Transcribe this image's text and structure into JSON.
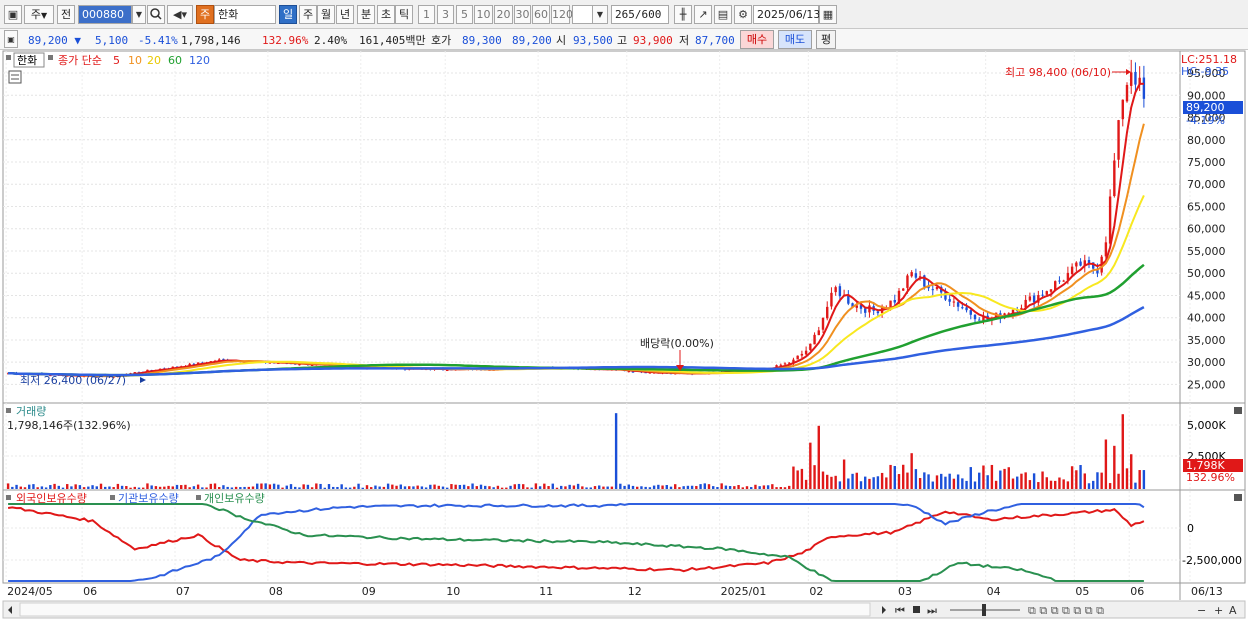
{
  "toolbar": {
    "market": "주",
    "prev": "전",
    "code": "000880",
    "name": "한화",
    "name_tag": "주",
    "periods": [
      "일",
      "주",
      "월",
      "년",
      "분",
      "초",
      "틱"
    ],
    "active_period": "일",
    "intervals": [
      "1",
      "3",
      "5",
      "10",
      "20",
      "30",
      "60",
      "120"
    ],
    "count": "265",
    "count_total": "/600",
    "date": "2025/06/13"
  },
  "quote": {
    "price": "89,200",
    "direction": "▼",
    "change": "5,100",
    "change_pct": "-5.41%",
    "volume": "1,798,146",
    "volume_ratio": "132.96%",
    "turnover": "2.40%",
    "amount": "161,405백만",
    "ask_label": "호가",
    "ask": "89,300",
    "bid": "89,200",
    "open_label": "시",
    "open": "93,500",
    "high_label": "고",
    "high": "93,900",
    "low_label": "저",
    "low": "87,700",
    "buy": "매수",
    "sell": "매도",
    "eval": "평"
  },
  "price_panel": {
    "title": "한화",
    "legend_label": "종가 단순",
    "ma_labels": [
      "5",
      "10",
      "20",
      "60",
      "120"
    ],
    "lc": "LC:251.18",
    "hc": "HC:-9.35",
    "high_annot": "최고 98,400 (06/10)",
    "low_annot": "최저 26,400 (06/27)",
    "dividend_annot": "배당락(0.00%)",
    "last_price": "89,200",
    "last_pct": "-4.19%"
  },
  "volume_panel": {
    "title": "거래량",
    "value": "1,798,146주(132.96%)",
    "last": "1,798K",
    "last_pct": "132.96%"
  },
  "holding_panel": {
    "foreign": "외국인보유수량",
    "inst": "기관보유수량",
    "indiv": "개인보유수량"
  },
  "colors": {
    "up": "#e01818",
    "down": "#1a4fd8",
    "ma5": "#e01818",
    "ma10": "#f09020",
    "ma20": "#f8e820",
    "ma60": "#20a030",
    "ma120": "#3060e0",
    "foreign": "#e01818",
    "inst": "#3060e0",
    "indiv": "#2a9050"
  },
  "chart_data": [
    {
      "type": "candlestick",
      "title": "한화",
      "y_ticks": [
        25000,
        30000,
        35000,
        40000,
        45000,
        50000,
        55000,
        60000,
        65000,
        70000,
        75000,
        80000,
        85000,
        90000,
        95000
      ],
      "y_tick_labels": [
        "25,000",
        "30,000",
        "35,000",
        "40,000",
        "45,000",
        "50,000",
        "55,000",
        "60,000",
        "65,000",
        "70,000",
        "75,000",
        "80,000",
        "85,000",
        "90,000",
        "95,000"
      ],
      "ylim": [
        21500,
        99500
      ],
      "x_labels": [
        "2024/05",
        "06",
        "07",
        "08",
        "09",
        "10",
        "11",
        "12",
        "2025/01",
        "02",
        "03",
        "04",
        "05",
        "06",
        "06/13"
      ],
      "close_anchors": [
        [
          0,
          27500
        ],
        [
          15,
          27000
        ],
        [
          25,
          26800
        ],
        [
          30,
          27700
        ],
        [
          40,
          29000
        ],
        [
          50,
          30500
        ],
        [
          60,
          30000
        ],
        [
          70,
          29600
        ],
        [
          80,
          29000
        ],
        [
          95,
          28500
        ],
        [
          110,
          28400
        ],
        [
          120,
          28600
        ],
        [
          130,
          28800
        ],
        [
          140,
          28400
        ],
        [
          150,
          27900
        ],
        [
          160,
          27400
        ],
        [
          170,
          27600
        ],
        [
          180,
          28600
        ],
        [
          186,
          30200
        ],
        [
          190,
          33500
        ],
        [
          194,
          42500
        ],
        [
          196,
          46500
        ],
        [
          200,
          43000
        ],
        [
          205,
          41500
        ],
        [
          210,
          44000
        ],
        [
          214,
          50000
        ],
        [
          218,
          47000
        ],
        [
          222,
          45000
        ],
        [
          228,
          41000
        ],
        [
          232,
          39500
        ],
        [
          238,
          42000
        ],
        [
          244,
          45000
        ],
        [
          250,
          49000
        ],
        [
          254,
          52000
        ],
        [
          258,
          51000
        ],
        [
          260,
          58000
        ],
        [
          262,
          75000
        ],
        [
          264,
          90000
        ],
        [
          266,
          96000
        ],
        [
          268,
          92000
        ],
        [
          269,
          89200
        ]
      ],
      "ma_labels": [
        "5",
        "10",
        "20",
        "60",
        "120"
      ],
      "annotations": [
        "최고 98,400 (06/10)",
        "최저 26,400 (06/27)",
        "배당락(0.00%)"
      ]
    },
    {
      "type": "bar",
      "title": "거래량",
      "y_tick_labels": [
        "5,000K",
        "2,500K"
      ],
      "ylim": [
        0,
        7500
      ],
      "spikes": [
        [
          144,
          7200
        ],
        [
          190,
          4400
        ],
        [
          192,
          6000
        ],
        [
          198,
          2800
        ],
        [
          212,
          2300
        ],
        [
          214,
          3400
        ],
        [
          260,
          4700
        ],
        [
          262,
          4100
        ],
        [
          264,
          7100
        ],
        [
          266,
          3300
        ],
        [
          269,
          1798
        ]
      ],
      "unit": "K"
    },
    {
      "type": "line",
      "title": "보유수량",
      "y_tick_labels": [
        "0",
        "-2,500,000"
      ],
      "series": [
        {
          "name": "외국인보유수량",
          "anchors": [
            [
              0,
              1500
            ],
            [
              20,
              500
            ],
            [
              30,
              -1500
            ],
            [
              45,
              -500
            ],
            [
              55,
              -2300
            ],
            [
              70,
              -2500
            ],
            [
              100,
              -2600
            ],
            [
              130,
              -2800
            ],
            [
              160,
              -3000
            ],
            [
              180,
              -2500
            ],
            [
              188,
              -1800
            ],
            [
              195,
              -600
            ],
            [
              210,
              -300
            ],
            [
              222,
              1200
            ],
            [
              232,
              600
            ],
            [
              250,
              1000
            ],
            [
              262,
              1300
            ],
            [
              266,
              200
            ],
            [
              269,
              500
            ]
          ]
        },
        {
          "name": "기관보유수량",
          "anchors": [
            [
              0,
              -4500
            ],
            [
              20,
              -4300
            ],
            [
              35,
              -3500
            ],
            [
              50,
              -2000
            ],
            [
              60,
              1000
            ],
            [
              80,
              1500
            ],
            [
              100,
              1600
            ],
            [
              140,
              1600
            ],
            [
              160,
              2000
            ],
            [
              188,
              2500
            ],
            [
              200,
              2300
            ],
            [
              215,
              1500
            ],
            [
              222,
              300
            ],
            [
              232,
              1200
            ],
            [
              250,
              2200
            ],
            [
              262,
              2500
            ],
            [
              269,
              1500
            ]
          ]
        },
        {
          "name": "개인보유수량",
          "anchors": [
            [
              0,
              2000
            ],
            [
              20,
              2300
            ],
            [
              40,
              2500
            ],
            [
              55,
              800
            ],
            [
              70,
              -500
            ],
            [
              100,
              -800
            ],
            [
              140,
              -1000
            ],
            [
              170,
              -1500
            ],
            [
              185,
              -2100
            ],
            [
              195,
              -3800
            ],
            [
              215,
              -4000
            ],
            [
              225,
              -2500
            ],
            [
              240,
              -3000
            ],
            [
              255,
              -4300
            ],
            [
              262,
              -4600
            ],
            [
              269,
              -4000
            ]
          ]
        }
      ]
    }
  ]
}
